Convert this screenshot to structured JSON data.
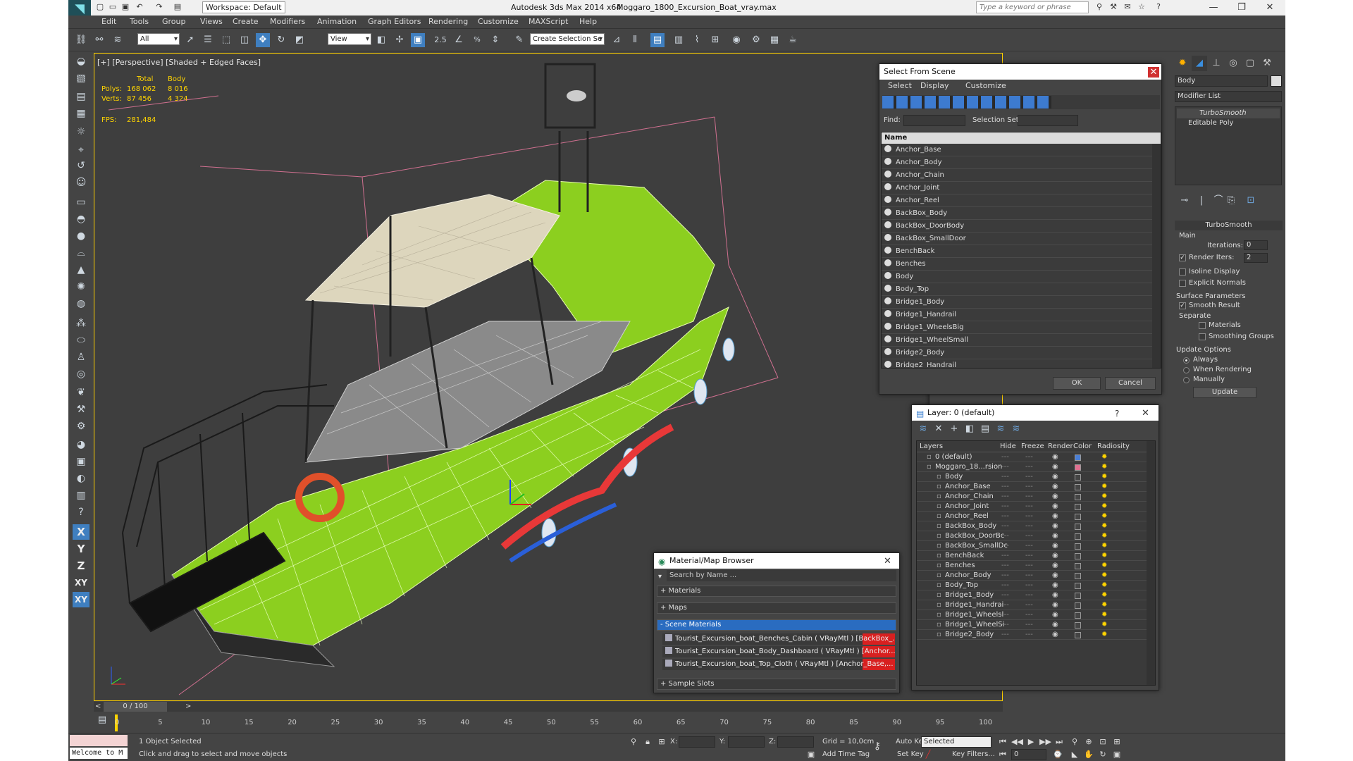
{
  "titlebar": {
    "workspace": "Workspace: Default",
    "app_title": "Autodesk 3ds Max  2014 x64",
    "file_title": "Moggaro_1800_Excursion_Boat_vray.max",
    "search_placeholder": "Type a keyword or phrase"
  },
  "menubar": [
    "Edit",
    "Tools",
    "Group",
    "Views",
    "Create",
    "Modifiers",
    "Animation",
    "Graph Editors",
    "Rendering",
    "Customize",
    "MAXScript",
    "Help"
  ],
  "toolbar": {
    "selection_filter": "All",
    "ref_coord": "View",
    "snap_label": "2.5",
    "selection_set_placeholder": "Create Selection Se"
  },
  "viewport": {
    "label": "[+] [Perspective] [Shaded + Edged Faces]",
    "stats": {
      "col_total": "Total",
      "col_body": "Body",
      "polys_label": "Polys:",
      "polys_total": "168 062",
      "polys_body": "8 016",
      "verts_label": "Verts:",
      "verts_total": "87 456",
      "verts_body": "4 324",
      "fps_label": "FPS:",
      "fps_value": "281,484"
    }
  },
  "select_from_scene": {
    "title": "Select From Scene",
    "menu": [
      "Select",
      "Display",
      "Customize"
    ],
    "find_label": "Find:",
    "selset_label": "Selection Set:",
    "col_name": "Name",
    "items": [
      "Anchor_Base",
      "Anchor_Body",
      "Anchor_Chain",
      "Anchor_Joint",
      "Anchor_Reel",
      "BackBox_Body",
      "BackBox_DoorBody",
      "BackBox_SmallDoor",
      "BenchBack",
      "Benches",
      "Body",
      "Body_Top",
      "Bridge1_Body",
      "Bridge1_Handrail",
      "Bridge1_WheelsBig",
      "Bridge1_WheelSmall",
      "Bridge2_Body",
      "Bridge2_Handrail"
    ],
    "ok": "OK",
    "cancel": "Cancel"
  },
  "layer_dialog": {
    "title": "Layer: 0 (default)",
    "help": "?",
    "columns": [
      "Layers",
      "Hide",
      "Freeze",
      "Render",
      "Color",
      "Radiosity"
    ],
    "rows": [
      {
        "name": "0 (default)",
        "color": "#4a7fd6"
      },
      {
        "name": "Moggaro_18...rsion",
        "color": "#e07090"
      },
      {
        "name": "Body",
        "color": "#444444"
      },
      {
        "name": "Anchor_Base",
        "color": "#444444"
      },
      {
        "name": "Anchor_Chain",
        "color": "#444444"
      },
      {
        "name": "Anchor_Joint",
        "color": "#444444"
      },
      {
        "name": "Anchor_Reel",
        "color": "#444444"
      },
      {
        "name": "BackBox_Body",
        "color": "#444444"
      },
      {
        "name": "BackBox_DoorBc",
        "color": "#444444"
      },
      {
        "name": "BackBox_SmallDc",
        "color": "#444444"
      },
      {
        "name": "BenchBack",
        "color": "#444444"
      },
      {
        "name": "Benches",
        "color": "#444444"
      },
      {
        "name": "Anchor_Body",
        "color": "#444444"
      },
      {
        "name": "Body_Top",
        "color": "#444444"
      },
      {
        "name": "Bridge1_Body",
        "color": "#444444"
      },
      {
        "name": "Bridge1_Handrai",
        "color": "#444444"
      },
      {
        "name": "Bridge1_Wheelsl",
        "color": "#444444"
      },
      {
        "name": "Bridge1_WheelSi",
        "color": "#444444"
      },
      {
        "name": "Bridge2_Body",
        "color": "#444444"
      }
    ]
  },
  "material_browser": {
    "title": "Material/Map Browser",
    "search_placeholder": "Search by Name ...",
    "groups": [
      "+ Materials",
      "+ Maps",
      "- Scene Materials"
    ],
    "materials": [
      "Tourist_Excursion_boat_Benches_Cabin  ( VRayMtl ) [BackBox_...",
      "Tourist_Excursion_boat_Body_Dashboard ( VRayMtl ) [Anchor...",
      "Tourist_Excursion_boat_Top_Cloth ( VRayMtl ) [Anchor_Base,..."
    ],
    "sample_slots": "+ Sample Slots"
  },
  "command_panel": {
    "object_name": "Body",
    "modifier_list": "Modifier List",
    "stack": [
      "TurboSmooth",
      "Editable Poly"
    ],
    "rollout_title": "TurboSmooth",
    "main_label": "Main",
    "iterations_label": "Iterations:",
    "iterations_value": "0",
    "render_iters_label": "Render Iters:",
    "render_iters_value": "2",
    "isoline": "Isoline Display",
    "explicit_normals": "Explicit Normals",
    "surface_params": "Surface Parameters",
    "smooth_result": "Smooth Result",
    "separate": "Separate",
    "materials": "Materials",
    "smoothing_groups": "Smoothing Groups",
    "update_options": "Update Options",
    "always": "Always",
    "when_rendering": "When Rendering",
    "manually": "Manually",
    "update_btn": "Update"
  },
  "timeline": {
    "frame": "0 / 100",
    "ticks": [
      "0",
      "5",
      "10",
      "15",
      "20",
      "25",
      "30",
      "35",
      "40",
      "45",
      "50",
      "55",
      "60",
      "65",
      "70",
      "75",
      "80",
      "85",
      "90",
      "95",
      "100"
    ]
  },
  "statusbar": {
    "maxscript": "Welcome to M",
    "selected": "1 Object Selected",
    "prompt": "Click and drag to select and move objects",
    "x_label": "X:",
    "y_label": "Y:",
    "z_label": "Z:",
    "grid": "Grid = 10,0cm",
    "add_time_tag": "Add Time Tag",
    "auto_key": "Auto Key",
    "auto_key_value": "Selected",
    "set_key": "Set Key",
    "key_filters": "Key Filters...",
    "frame_value": "0"
  }
}
